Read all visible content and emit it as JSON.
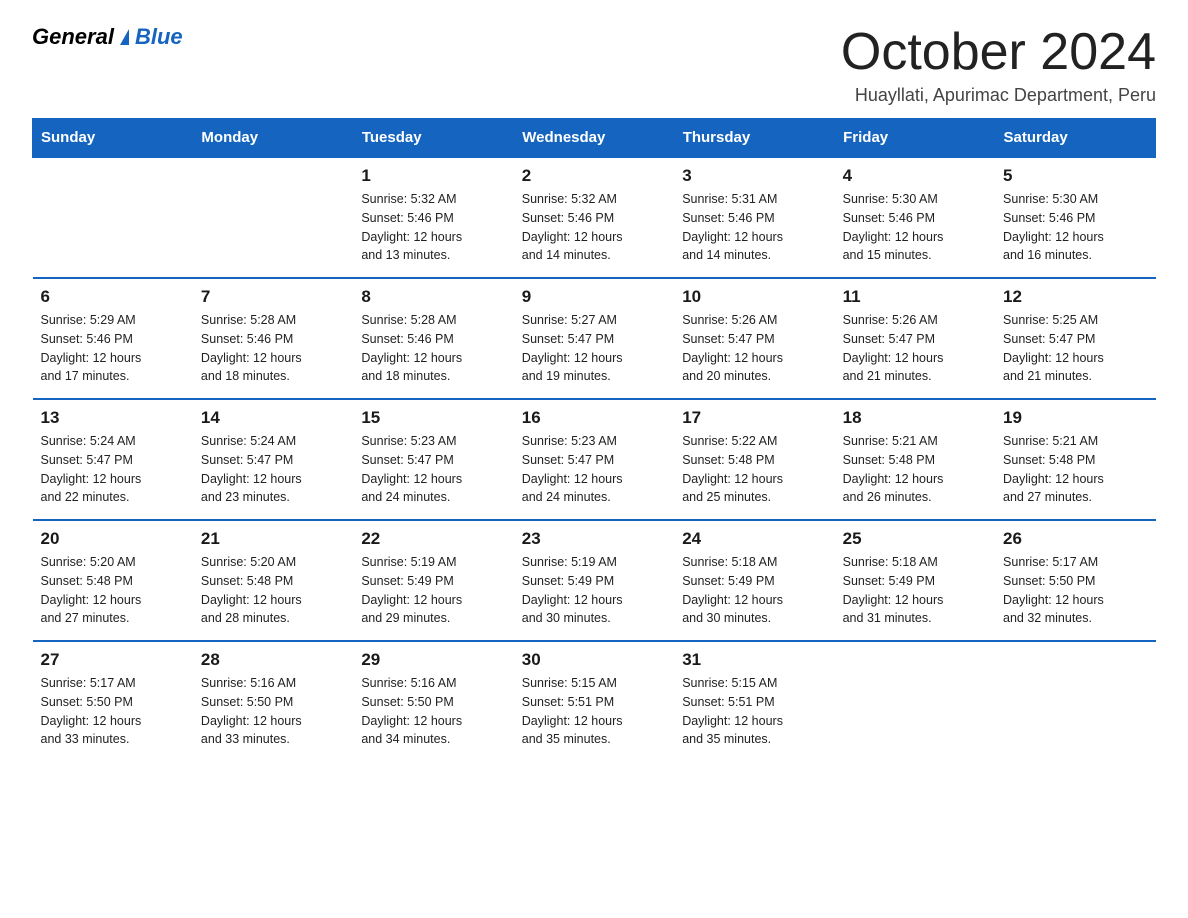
{
  "logo": {
    "general": "General",
    "blue": "Blue"
  },
  "header": {
    "month_year": "October 2024",
    "location": "Huayllati, Apurimac Department, Peru"
  },
  "weekdays": [
    "Sunday",
    "Monday",
    "Tuesday",
    "Wednesday",
    "Thursday",
    "Friday",
    "Saturday"
  ],
  "weeks": [
    [
      {
        "day": "",
        "info": ""
      },
      {
        "day": "",
        "info": ""
      },
      {
        "day": "1",
        "info": "Sunrise: 5:32 AM\nSunset: 5:46 PM\nDaylight: 12 hours\nand 13 minutes."
      },
      {
        "day": "2",
        "info": "Sunrise: 5:32 AM\nSunset: 5:46 PM\nDaylight: 12 hours\nand 14 minutes."
      },
      {
        "day": "3",
        "info": "Sunrise: 5:31 AM\nSunset: 5:46 PM\nDaylight: 12 hours\nand 14 minutes."
      },
      {
        "day": "4",
        "info": "Sunrise: 5:30 AM\nSunset: 5:46 PM\nDaylight: 12 hours\nand 15 minutes."
      },
      {
        "day": "5",
        "info": "Sunrise: 5:30 AM\nSunset: 5:46 PM\nDaylight: 12 hours\nand 16 minutes."
      }
    ],
    [
      {
        "day": "6",
        "info": "Sunrise: 5:29 AM\nSunset: 5:46 PM\nDaylight: 12 hours\nand 17 minutes."
      },
      {
        "day": "7",
        "info": "Sunrise: 5:28 AM\nSunset: 5:46 PM\nDaylight: 12 hours\nand 18 minutes."
      },
      {
        "day": "8",
        "info": "Sunrise: 5:28 AM\nSunset: 5:46 PM\nDaylight: 12 hours\nand 18 minutes."
      },
      {
        "day": "9",
        "info": "Sunrise: 5:27 AM\nSunset: 5:47 PM\nDaylight: 12 hours\nand 19 minutes."
      },
      {
        "day": "10",
        "info": "Sunrise: 5:26 AM\nSunset: 5:47 PM\nDaylight: 12 hours\nand 20 minutes."
      },
      {
        "day": "11",
        "info": "Sunrise: 5:26 AM\nSunset: 5:47 PM\nDaylight: 12 hours\nand 21 minutes."
      },
      {
        "day": "12",
        "info": "Sunrise: 5:25 AM\nSunset: 5:47 PM\nDaylight: 12 hours\nand 21 minutes."
      }
    ],
    [
      {
        "day": "13",
        "info": "Sunrise: 5:24 AM\nSunset: 5:47 PM\nDaylight: 12 hours\nand 22 minutes."
      },
      {
        "day": "14",
        "info": "Sunrise: 5:24 AM\nSunset: 5:47 PM\nDaylight: 12 hours\nand 23 minutes."
      },
      {
        "day": "15",
        "info": "Sunrise: 5:23 AM\nSunset: 5:47 PM\nDaylight: 12 hours\nand 24 minutes."
      },
      {
        "day": "16",
        "info": "Sunrise: 5:23 AM\nSunset: 5:47 PM\nDaylight: 12 hours\nand 24 minutes."
      },
      {
        "day": "17",
        "info": "Sunrise: 5:22 AM\nSunset: 5:48 PM\nDaylight: 12 hours\nand 25 minutes."
      },
      {
        "day": "18",
        "info": "Sunrise: 5:21 AM\nSunset: 5:48 PM\nDaylight: 12 hours\nand 26 minutes."
      },
      {
        "day": "19",
        "info": "Sunrise: 5:21 AM\nSunset: 5:48 PM\nDaylight: 12 hours\nand 27 minutes."
      }
    ],
    [
      {
        "day": "20",
        "info": "Sunrise: 5:20 AM\nSunset: 5:48 PM\nDaylight: 12 hours\nand 27 minutes."
      },
      {
        "day": "21",
        "info": "Sunrise: 5:20 AM\nSunset: 5:48 PM\nDaylight: 12 hours\nand 28 minutes."
      },
      {
        "day": "22",
        "info": "Sunrise: 5:19 AM\nSunset: 5:49 PM\nDaylight: 12 hours\nand 29 minutes."
      },
      {
        "day": "23",
        "info": "Sunrise: 5:19 AM\nSunset: 5:49 PM\nDaylight: 12 hours\nand 30 minutes."
      },
      {
        "day": "24",
        "info": "Sunrise: 5:18 AM\nSunset: 5:49 PM\nDaylight: 12 hours\nand 30 minutes."
      },
      {
        "day": "25",
        "info": "Sunrise: 5:18 AM\nSunset: 5:49 PM\nDaylight: 12 hours\nand 31 minutes."
      },
      {
        "day": "26",
        "info": "Sunrise: 5:17 AM\nSunset: 5:50 PM\nDaylight: 12 hours\nand 32 minutes."
      }
    ],
    [
      {
        "day": "27",
        "info": "Sunrise: 5:17 AM\nSunset: 5:50 PM\nDaylight: 12 hours\nand 33 minutes."
      },
      {
        "day": "28",
        "info": "Sunrise: 5:16 AM\nSunset: 5:50 PM\nDaylight: 12 hours\nand 33 minutes."
      },
      {
        "day": "29",
        "info": "Sunrise: 5:16 AM\nSunset: 5:50 PM\nDaylight: 12 hours\nand 34 minutes."
      },
      {
        "day": "30",
        "info": "Sunrise: 5:15 AM\nSunset: 5:51 PM\nDaylight: 12 hours\nand 35 minutes."
      },
      {
        "day": "31",
        "info": "Sunrise: 5:15 AM\nSunset: 5:51 PM\nDaylight: 12 hours\nand 35 minutes."
      },
      {
        "day": "",
        "info": ""
      },
      {
        "day": "",
        "info": ""
      }
    ]
  ]
}
